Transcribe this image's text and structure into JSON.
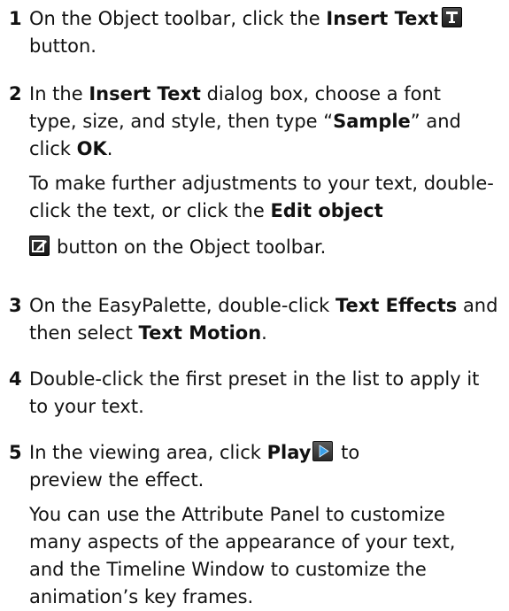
{
  "steps": [
    {
      "number": "1",
      "line1_pre": "On the Object toolbar, click the ",
      "line1_bold": "Insert Text",
      "line2": "button.",
      "icon": "insert-text-icon"
    },
    {
      "number": "2",
      "pre1": "In the ",
      "bold1": "Insert Text",
      "mid1": " dialog box, choose a font type, size, and style, then type “",
      "bold2": "Sample",
      "mid2": "” and click ",
      "bold3": "OK",
      "post": ".",
      "note_pre": "To make further adjustments to your text, double-click the text, or click the ",
      "note_bold": "Edit object",
      "note_post": "button on the Object toolbar.",
      "icon": "edit-object-icon"
    },
    {
      "number": "3",
      "pre": "On the EasyPalette, double-click ",
      "bold1": "Text Effects",
      "mid": " and then select ",
      "bold2": "Text Motion",
      "post": "."
    },
    {
      "number": "4",
      "text": "Double-click the first preset in the list to apply it to your text."
    },
    {
      "number": "5",
      "pre": "In the viewing area, click ",
      "bold": "Play",
      "post": " to preview the effect.",
      "note": "You can use the Attribute Panel to customize many aspects of the appearance of your text, and the Timeline Window to customize the animation’s key frames.",
      "icon": "play-icon"
    }
  ],
  "colors": {
    "text": "#111111",
    "icon_bg": "#222222",
    "play_arrow": "#3aa0e8"
  }
}
